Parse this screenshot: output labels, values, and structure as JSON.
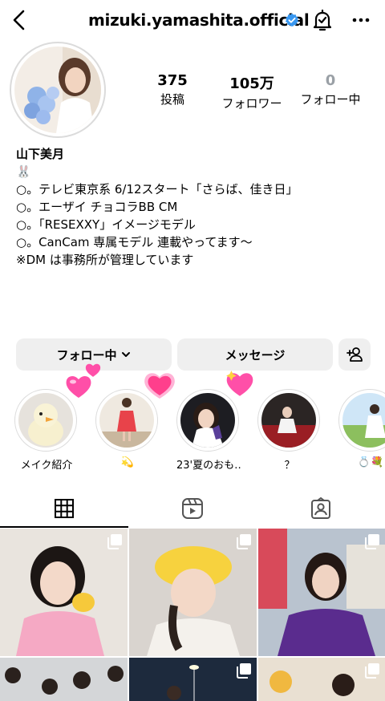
{
  "header": {
    "username": "mizuki.yamashita.official",
    "icons": {
      "back": "chevron-left-icon",
      "verified": "verified-badge-icon",
      "bell": "notification-bell-icon",
      "more": "more-icon"
    },
    "colors": {
      "verified": "#3897f0"
    }
  },
  "profile": {
    "stats": {
      "posts": {
        "value": "375",
        "label": "投稿"
      },
      "followers": {
        "value": "105万",
        "label": "フォロワー"
      },
      "following": {
        "value": "0",
        "label": "フォロー中"
      }
    },
    "name": "山下美月",
    "emoji": "🐰",
    "bio_lines": [
      "○。テレビ東京系 6/12スタート「さらば、佳き日」",
      "○。エーザイ チョコラBB CM",
      "○。「RESEXXY」イメージモデル",
      "○。CanCam 専属モデル 連載やってます〜",
      "※DM は事務所が管理しています"
    ]
  },
  "actions": {
    "follow": "フォロー中",
    "message": "メッセージ",
    "icons": {
      "follow_chevron": "chevron-down-icon",
      "add_person": "add-person-icon"
    }
  },
  "highlights": [
    {
      "caption": "メイク紹介"
    },
    {
      "caption": "💫"
    },
    {
      "caption": "23'夏のおも…"
    },
    {
      "caption": "？"
    },
    {
      "caption": "💍💐"
    }
  ],
  "tabs": {
    "icons": [
      "grid-icon",
      "reels-icon",
      "tagged-icon"
    ]
  },
  "grid": {
    "icons": {
      "multi": "multiple-photos-icon"
    }
  }
}
